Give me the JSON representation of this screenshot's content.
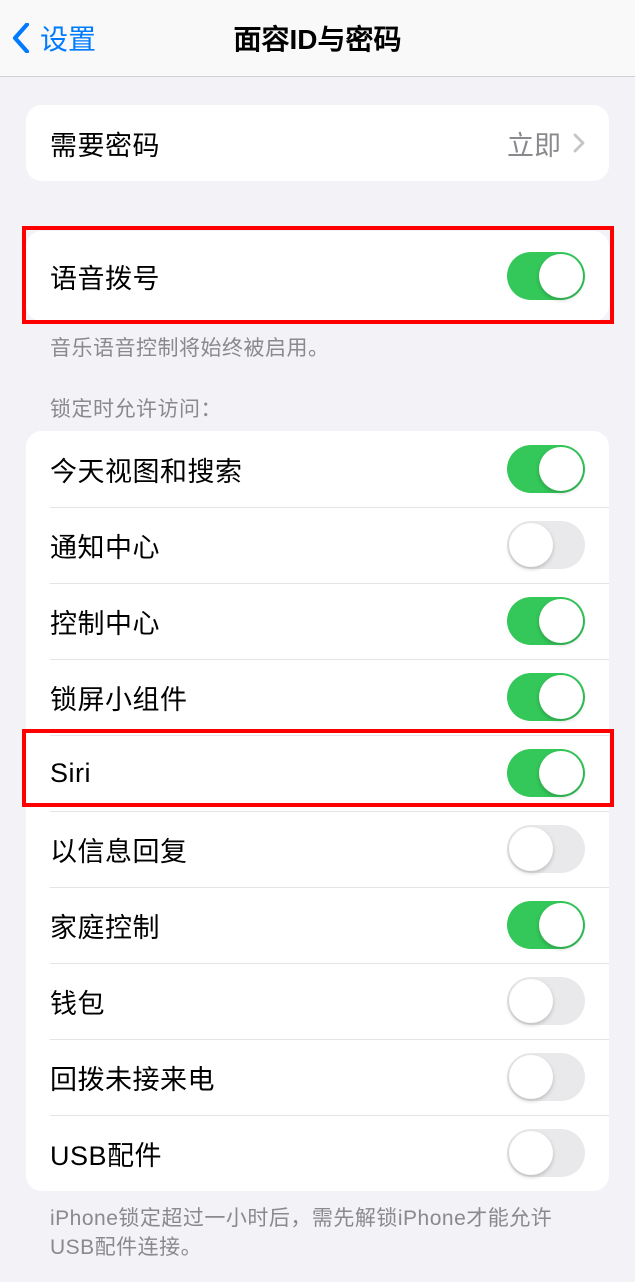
{
  "nav": {
    "back_label": "设置",
    "title": "面容ID与密码"
  },
  "passcode_row": {
    "label": "需要密码",
    "value": "立即"
  },
  "voice_dial": {
    "label": "语音拨号",
    "on": true,
    "footer": "音乐语音控制将始终被启用。"
  },
  "lock_access": {
    "header": "锁定时允许访问：",
    "items": [
      {
        "label": "今天视图和搜索",
        "on": true
      },
      {
        "label": "通知中心",
        "on": false
      },
      {
        "label": "控制中心",
        "on": true
      },
      {
        "label": "锁屏小组件",
        "on": true
      },
      {
        "label": "Siri",
        "on": true
      },
      {
        "label": "以信息回复",
        "on": false
      },
      {
        "label": "家庭控制",
        "on": true
      },
      {
        "label": "钱包",
        "on": false
      },
      {
        "label": "回拨未接来电",
        "on": false
      },
      {
        "label": "USB配件",
        "on": false
      }
    ],
    "footer": "iPhone锁定超过一小时后，需先解锁iPhone才能允许USB配件连接。"
  }
}
